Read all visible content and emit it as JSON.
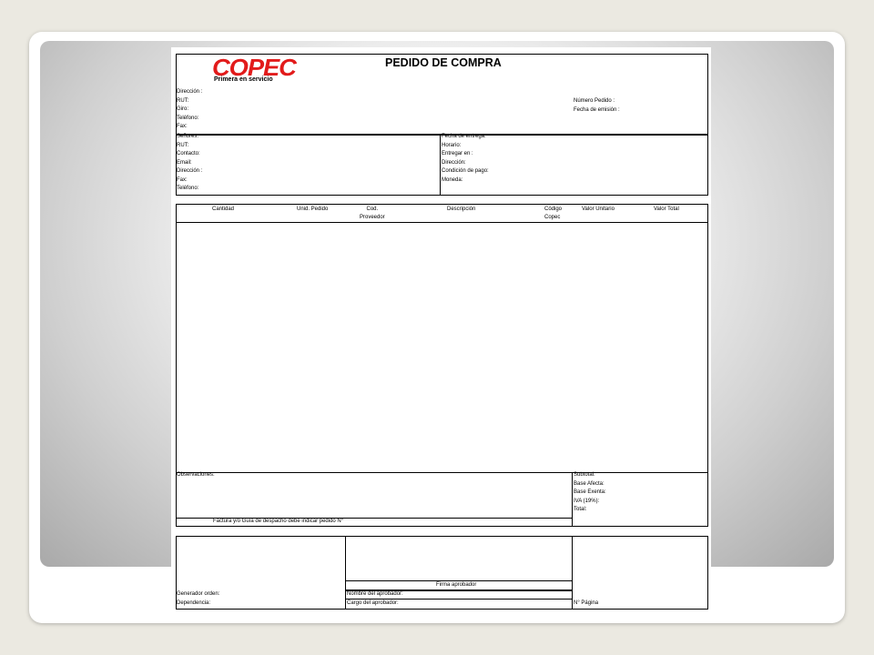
{
  "document": {
    "brand": {
      "logo_text": "COPEC",
      "tagline": "Primera en servicio"
    },
    "title": "PEDIDO DE COMPRA",
    "company_fields": [
      "Dirección :",
      "RUT:",
      "Giro:",
      "Teléfono:",
      "Fax:"
    ],
    "order_fields": [
      "Número Pedido :",
      "Fecha de emisión :"
    ],
    "supplier_fields": [
      "Señores:",
      "RUT:",
      "Contacto:",
      "Email:",
      "Dirección :",
      "Fax:",
      "Teléfono:"
    ],
    "delivery_fields": [
      "Fecha de entrega:",
      "Horario:",
      "Entregar en :",
      "Dirección:",
      "Condición de pago:",
      "Moneda:"
    ],
    "table_headers": {
      "cantidad": "Cantidad",
      "unid_pedido": "Unid. Pedido",
      "cod_proveedor": [
        "Cod.",
        "Proveedor"
      ],
      "descripcion": "Descripción",
      "codigo_copec": [
        "Código",
        "Copec"
      ],
      "valor_unitario": "Valor Unitario",
      "valor_total": "Valor Total"
    },
    "observaciones_label": "Observaciones:",
    "totals": [
      "Subtotal:",
      "Base Afecta:",
      "Base Exenta:",
      "IVA (19%):",
      "Total:"
    ],
    "invoice_note": "Factura y/o Guía de despacho debe indicar pedido N°",
    "footer": {
      "generador": "Generador orden:",
      "dependencia": "Dependencia:",
      "firma_aprobador": "Firma aprobador",
      "nombre_aprobador": "Nombre del aprobador:",
      "cargo_aprobador": "Cargo del aprobador:",
      "pagina": "N° Página"
    }
  },
  "colors": {
    "brand_red": "#e21b1b",
    "background": "#ebe9e1"
  }
}
